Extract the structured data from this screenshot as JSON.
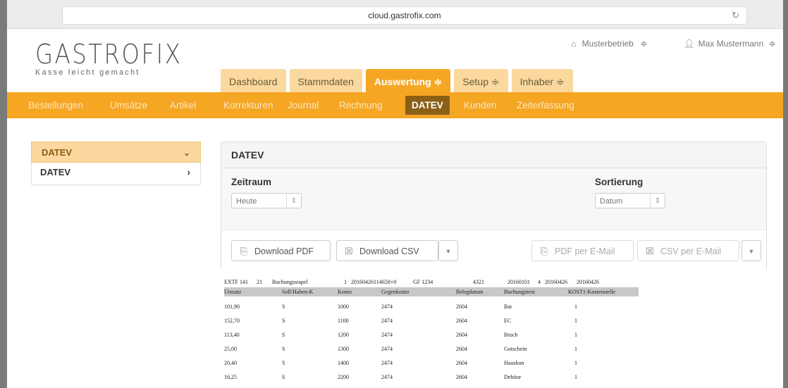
{
  "browser": {
    "url": "cloud.gastrofix.com"
  },
  "brand": {
    "name": "GASTROFIX",
    "tagline": "Kasse leicht gemacht"
  },
  "account": {
    "business": "Musterbetrieb",
    "user": "Max Mustermann"
  },
  "tabs": [
    {
      "label": "Dashboard"
    },
    {
      "label": "Stammdaten"
    },
    {
      "label": "Auswertung ≑"
    },
    {
      "label": "Setup ≑"
    },
    {
      "label": "Inhaber ≑"
    }
  ],
  "subnav": [
    {
      "label": "Bestellungen"
    },
    {
      "label": "Umsätze"
    },
    {
      "label": "Artikel"
    },
    {
      "label": "Korrekturen"
    },
    {
      "label": "Journal"
    },
    {
      "label": "Rechnung"
    },
    {
      "label": "DATEV"
    },
    {
      "label": "Kunden"
    },
    {
      "label": "Zeiterfassung"
    }
  ],
  "sidebar": {
    "title": "DATEV",
    "items": [
      {
        "label": "DATEV"
      }
    ]
  },
  "panel": {
    "title": "DATEV",
    "period_label": "Zeitraum",
    "period_value": "Heute",
    "sort_label": "Sortierung",
    "sort_value": "Datum",
    "buttons": {
      "download_pdf": "Download PDF",
      "download_csv": "Download CSV",
      "pdf_email": "PDF per E-Mail",
      "csv_email": "CSV per E-Mail"
    }
  },
  "export": {
    "meta": [
      "EXTF 141",
      "21",
      "Buchungsstapel",
      "1",
      "20160426114658+0",
      "GF 1234",
      "4321",
      "20160101",
      "4",
      "20160426",
      "20160426"
    ],
    "columns": [
      "Umsatz",
      "Soll/Haben-K",
      "Konto",
      "Gegenkonto",
      "Belegdatum",
      "Buchungstext",
      "KOST1-Kostenstelle"
    ],
    "rows": [
      [
        "101,90",
        "S",
        "1000",
        "2474",
        "2604",
        "Bar",
        "1"
      ],
      [
        "152,70",
        "S",
        "1100",
        "2474",
        "2604",
        "EC",
        "1"
      ],
      [
        "113,40",
        "S",
        "1200",
        "2474",
        "2604",
        "Bruch",
        "1"
      ],
      [
        "25,00",
        "S",
        "1300",
        "2474",
        "2604",
        "Gutschein",
        "1"
      ],
      [
        "20,40",
        "S",
        "1400",
        "2474",
        "2604",
        "Haushon",
        "1"
      ],
      [
        "16,25",
        "S",
        "2200",
        "2474",
        "2604",
        "Debitor",
        "1"
      ]
    ]
  }
}
